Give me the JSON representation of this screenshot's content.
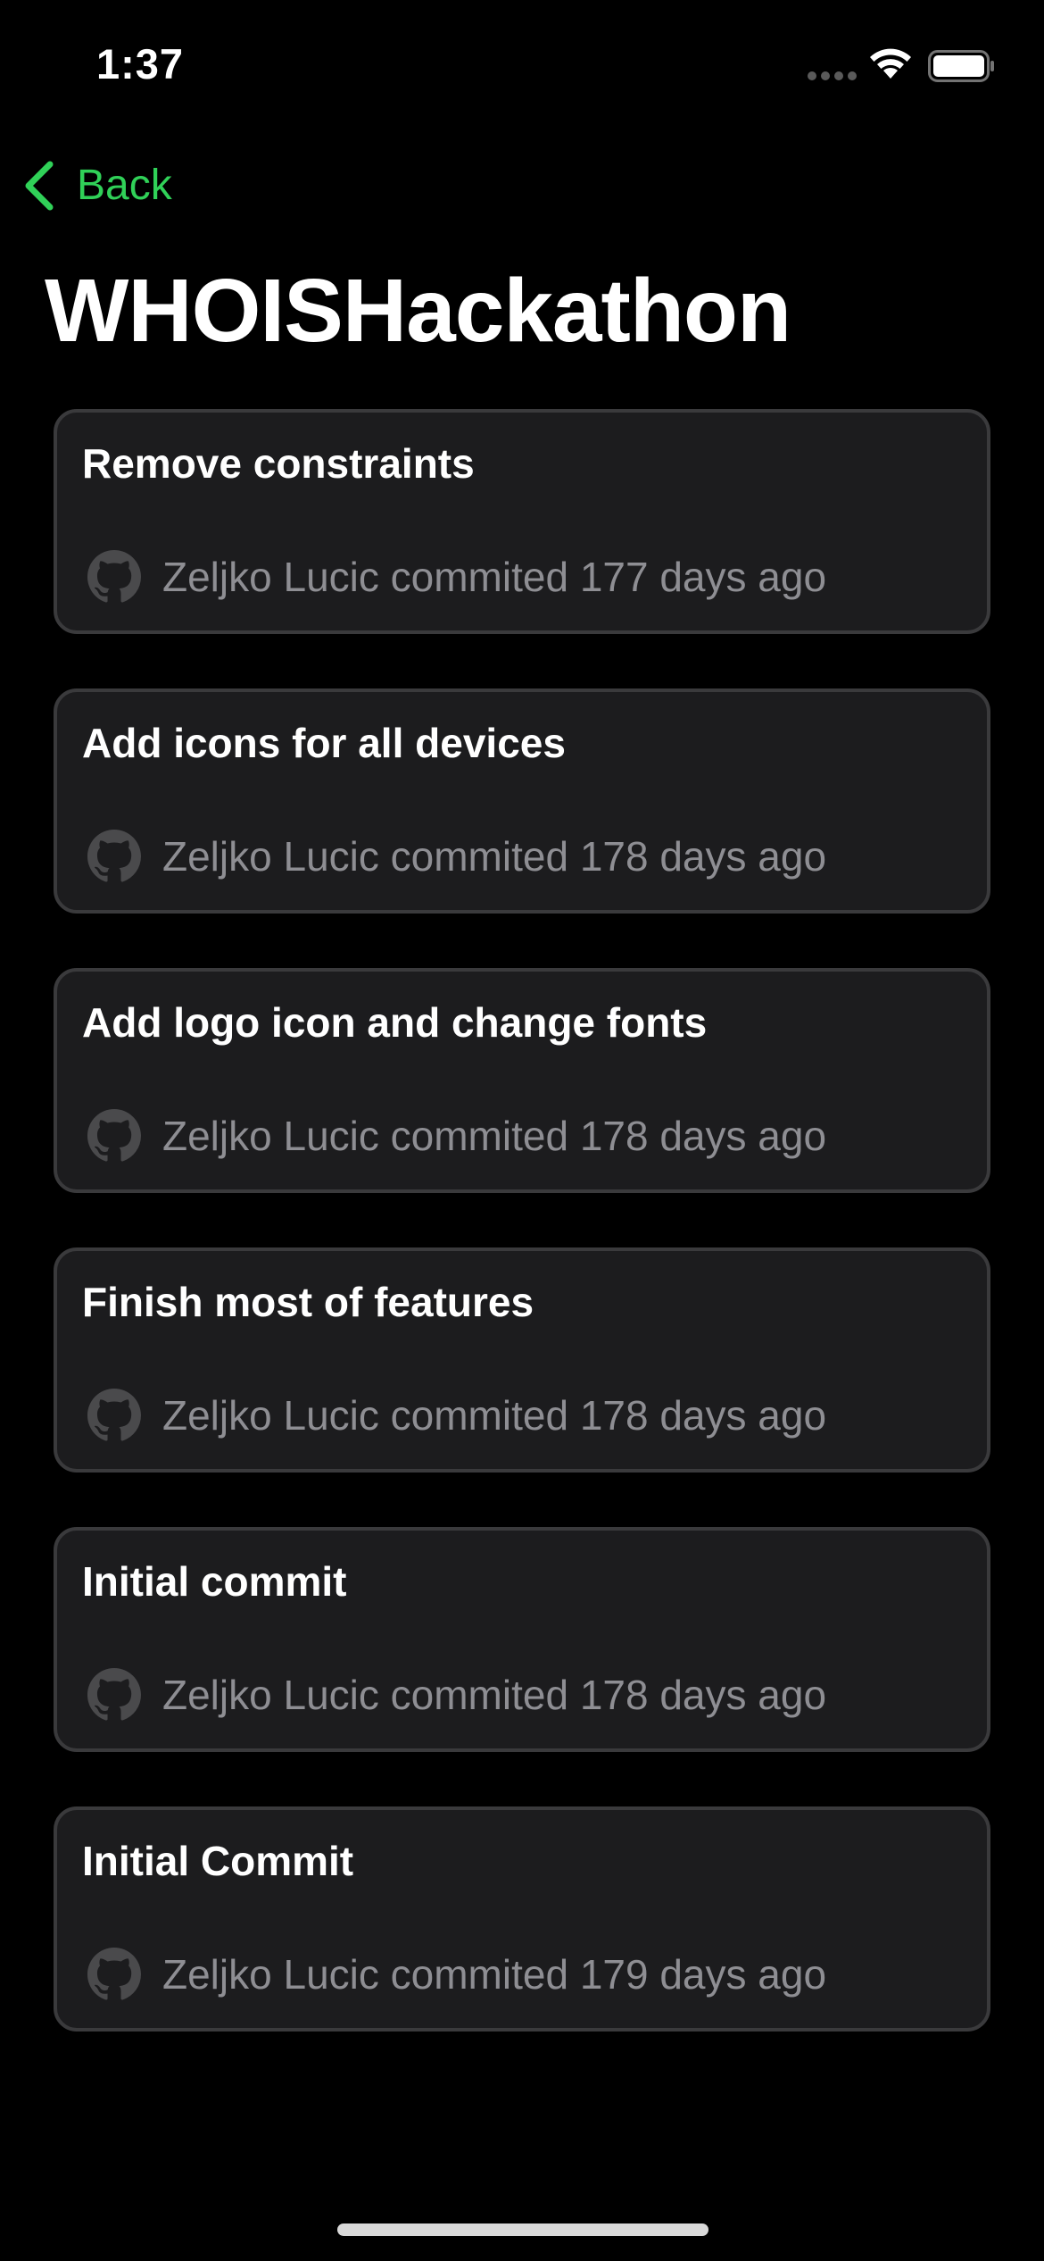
{
  "status_bar": {
    "time": "1:37",
    "wifi_icon": "wifi-icon",
    "battery_icon": "battery-icon",
    "signal_icon": "cellular-signal-icon"
  },
  "nav": {
    "back_label": "Back",
    "back_icon": "chevron-left-icon"
  },
  "title": "WHOISHackathon",
  "colors": {
    "background": "#000000",
    "card_background": "#1c1c1e",
    "card_border": "#3a3a3c",
    "accent": "#30d158",
    "secondary_text": "#8e8e93"
  },
  "commits": [
    {
      "message": "Remove constraints",
      "author_line": "Zeljko Lucic commited 177 days ago",
      "icon": "github-icon"
    },
    {
      "message": "Add icons for all devices",
      "author_line": "Zeljko Lucic commited 178 days ago",
      "icon": "github-icon"
    },
    {
      "message": "Add logo icon and change fonts",
      "author_line": "Zeljko Lucic commited 178 days ago",
      "icon": "github-icon"
    },
    {
      "message": "Finish most of features",
      "author_line": "Zeljko Lucic commited 178 days ago",
      "icon": "github-icon"
    },
    {
      "message": "Initial commit",
      "author_line": "Zeljko Lucic commited 178 days ago",
      "icon": "github-icon"
    },
    {
      "message": "Initial Commit",
      "author_line": "Zeljko Lucic commited 179 days ago",
      "icon": "github-icon"
    }
  ]
}
